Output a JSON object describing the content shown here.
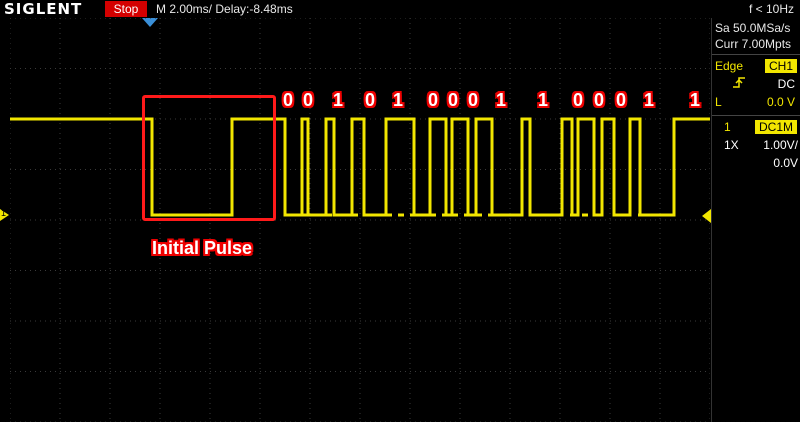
{
  "header": {
    "brand": "SIGLENT",
    "run_status": "Stop",
    "timebase": "M 2.00ms/ Delay:-8.48ms",
    "frequency": "f < 10Hz"
  },
  "acquisition": {
    "sample_rate": "Sa 50.0MSa/s",
    "memory_depth": "Curr 7.00Mpts"
  },
  "trigger": {
    "type": "Edge",
    "source": "CH1",
    "slope_icon": "rising-edge-icon",
    "coupling": "DC",
    "level_label": "L",
    "level_value": "0.0 V"
  },
  "channel": {
    "number": "1",
    "coupling_badge": "DC1M",
    "probe": "1X",
    "scale": "1.00V/",
    "offset": "0.0V",
    "marker_label": "1"
  },
  "annotations": {
    "initial_pulse_label": "Initial Pulse",
    "bits": [
      "0",
      "0",
      "1",
      "0",
      "1",
      "0",
      "0",
      "0",
      "1",
      "1",
      "0",
      "0",
      "0",
      "1",
      "1"
    ]
  },
  "colors": {
    "trace": "#f2e600",
    "stop_badge": "#d40000",
    "annotation": "#ff1a1a",
    "trigger_marker": "#3a8fd8"
  }
}
